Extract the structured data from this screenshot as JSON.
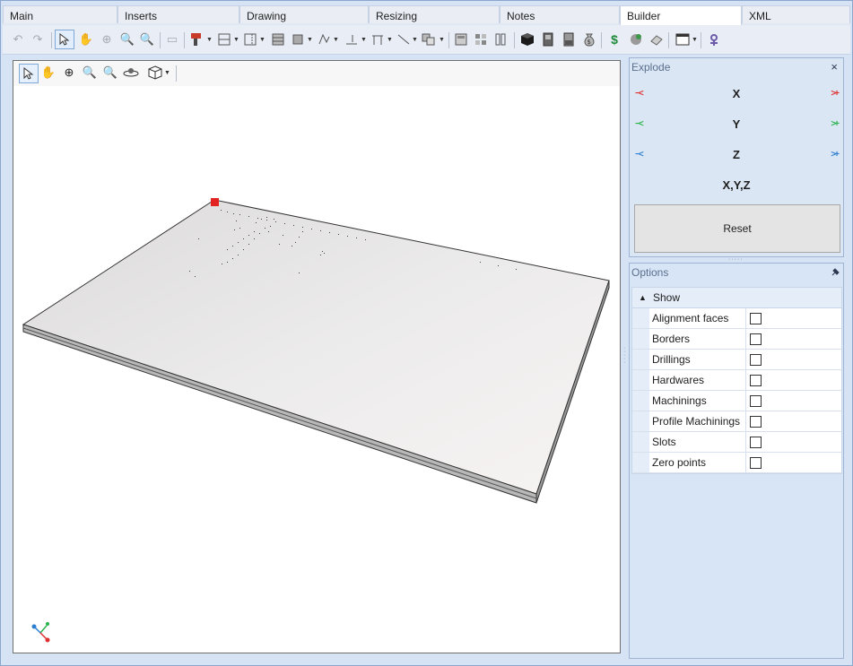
{
  "tabs": [
    {
      "label": "Main",
      "active": false
    },
    {
      "label": "Inserts",
      "active": false
    },
    {
      "label": "Drawing",
      "active": false
    },
    {
      "label": "Resizing",
      "active": false
    },
    {
      "label": "Notes",
      "active": false
    },
    {
      "label": "Builder",
      "active": true
    },
    {
      "label": "XML",
      "active": false
    }
  ],
  "toolbar_icons": [
    "undo-icon",
    "redo-icon",
    "select-icon",
    "pan-icon",
    "zoom-in-icon",
    "zoom-window-icon",
    "zoom-extents-icon",
    "copy-icon",
    "drill-icon",
    "horizontal-divider-icon",
    "vertical-divider-icon",
    "shelves-icon",
    "hinge-icon",
    "drawer-icon",
    "edge-band-icon",
    "frame-icon",
    "line-icon",
    "group-icon",
    "calculator-icon",
    "texture-icon",
    "split-icon",
    "cube-icon",
    "cabinet-icon",
    "panel-icon",
    "money-bag-icon",
    "price-icon",
    "material-icon",
    "eraser-icon",
    "window-icon",
    "settings-icon"
  ],
  "viewport": {
    "toolbar_icons": [
      "select-icon",
      "pan-icon",
      "zoom-in-icon",
      "zoom-window-icon",
      "zoom-extents-icon",
      "orbit-icon",
      "view-cube-icon"
    ]
  },
  "explode": {
    "title": "Explode",
    "close": "×",
    "x_label": "X",
    "y_label": "Y",
    "z_label": "Z",
    "xyz_label": "X,Y,Z",
    "minus_arrow": "−<",
    "plus_arrow": ">+",
    "reset_label": "Reset",
    "colors": {
      "x": "#e03030",
      "y": "#2ab34a",
      "z": "#2d7fd0"
    }
  },
  "options": {
    "title": "Options",
    "group_label": "Show",
    "items": [
      {
        "label": "Alignment faces",
        "checked": false
      },
      {
        "label": "Borders",
        "checked": false
      },
      {
        "label": "Drillings",
        "checked": false
      },
      {
        "label": "Hardwares",
        "checked": false
      },
      {
        "label": "Machinings",
        "checked": false
      },
      {
        "label": "Profile Machinings",
        "checked": false
      },
      {
        "label": "Slots",
        "checked": false
      },
      {
        "label": "Zero points",
        "checked": false
      }
    ]
  }
}
